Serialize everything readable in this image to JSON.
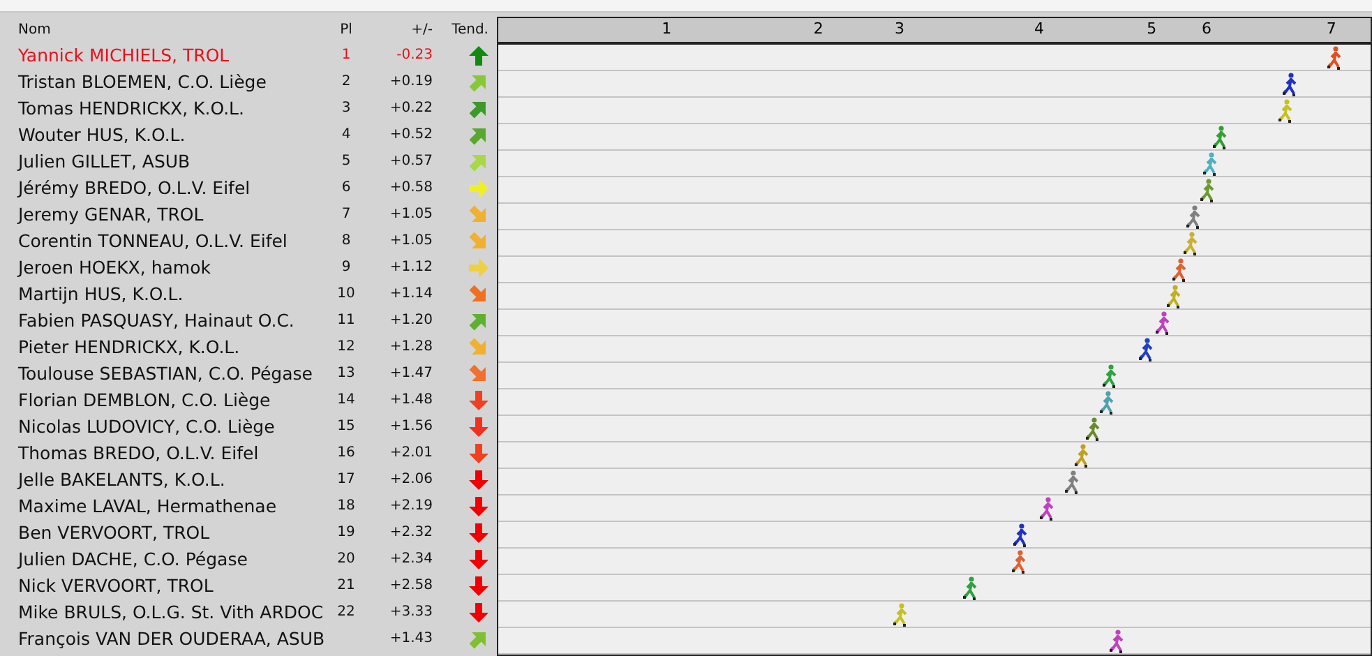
{
  "header": {
    "name": "Nom",
    "place": "Pl",
    "diff": "+/-",
    "trend": "Tend."
  },
  "ticks": [
    {
      "label": "1",
      "level": 0.193
    },
    {
      "label": "2",
      "level": 0.367
    },
    {
      "label": "3",
      "level": 0.46
    },
    {
      "label": "4",
      "level": 0.62
    },
    {
      "label": "5",
      "level": 0.749
    },
    {
      "label": "6",
      "level": 0.812
    },
    {
      "label": "7",
      "level": 0.955
    }
  ],
  "rows": [
    {
      "name": "Yannick MICHIELS, TROL",
      "place": "1",
      "diff": "-0.23",
      "selected": true,
      "trend": {
        "kind": "up",
        "color": "#108a10"
      },
      "runner": {
        "level": 0.958,
        "color": "#e05020"
      }
    },
    {
      "name": "Tristan BLOEMEN, C.O. Liège",
      "place": "2",
      "diff": "+0.19",
      "selected": false,
      "trend": {
        "kind": "up-right",
        "color": "#88c838"
      },
      "runner": {
        "level": 0.907,
        "color": "#2030c0"
      }
    },
    {
      "name": "Tomas HENDRICKX, K.O.L.",
      "place": "3",
      "diff": "+0.22",
      "selected": false,
      "trend": {
        "kind": "up-right",
        "color": "#3c9a28"
      },
      "runner": {
        "level": 0.903,
        "color": "#c8c020"
      }
    },
    {
      "name": "Wouter HUS, K.O.L.",
      "place": "4",
      "diff": "+0.52",
      "selected": false,
      "trend": {
        "kind": "up-right",
        "color": "#58a830"
      },
      "runner": {
        "level": 0.827,
        "color": "#30a030"
      }
    },
    {
      "name": "Julien GILLET, ASUB",
      "place": "5",
      "diff": "+0.57",
      "selected": false,
      "trend": {
        "kind": "up-right",
        "color": "#a8d848"
      },
      "runner": {
        "level": 0.816,
        "color": "#50b0c0"
      }
    },
    {
      "name": "Jérémy BREDO, O.L.V. Eifel",
      "place": "6",
      "diff": "+0.58",
      "selected": false,
      "trend": {
        "kind": "right",
        "color": "#f0f020"
      },
      "runner": {
        "level": 0.812,
        "color": "#6a9a30"
      }
    },
    {
      "name": "Jeremy GENAR, TROL",
      "place": "7",
      "diff": "+1.05",
      "selected": false,
      "trend": {
        "kind": "down-right",
        "color": "#f0b030"
      },
      "runner": {
        "level": 0.796,
        "color": "#808080"
      }
    },
    {
      "name": "Corentin TONNEAU, O.L.V. Eifel",
      "place": "8",
      "diff": "+1.05",
      "selected": false,
      "trend": {
        "kind": "down-right",
        "color": "#f0b030"
      },
      "runner": {
        "level": 0.794,
        "color": "#c8b030"
      }
    },
    {
      "name": "Jeroen HOEKX, hamok",
      "place": "9",
      "diff": "+1.12",
      "selected": false,
      "trend": {
        "kind": "right",
        "color": "#f0d040"
      },
      "runner": {
        "level": 0.781,
        "color": "#e06030"
      }
    },
    {
      "name": "Martijn HUS, K.O.L.",
      "place": "10",
      "diff": "+1.14",
      "selected": false,
      "trend": {
        "kind": "down-right",
        "color": "#f07020"
      },
      "runner": {
        "level": 0.775,
        "color": "#c0b020"
      }
    },
    {
      "name": "Fabien PASQUASY, Hainaut O.C.",
      "place": "11",
      "diff": "+1.20",
      "selected": false,
      "trend": {
        "kind": "up-right",
        "color": "#60b030"
      },
      "runner": {
        "level": 0.762,
        "color": "#c040c0"
      }
    },
    {
      "name": "Pieter HENDRICKX, K.O.L.",
      "place": "12",
      "diff": "+1.28",
      "selected": false,
      "trend": {
        "kind": "down-right",
        "color": "#f0b030"
      },
      "runner": {
        "level": 0.743,
        "color": "#2040c0"
      }
    },
    {
      "name": "Toulouse SEBASTIAN, C.O. Pégase",
      "place": "13",
      "diff": "+1.47",
      "selected": false,
      "trend": {
        "kind": "down-right",
        "color": "#f07030"
      },
      "runner": {
        "level": 0.7,
        "color": "#30a040"
      }
    },
    {
      "name": "Florian DEMBLON, C.O. Liège",
      "place": "14",
      "diff": "+1.48",
      "selected": false,
      "trend": {
        "kind": "down",
        "color": "#f04020"
      },
      "runner": {
        "level": 0.698,
        "color": "#50a0b0"
      }
    },
    {
      "name": "Nicolas LUDOVICY, C.O. Liège",
      "place": "15",
      "diff": "+1.56",
      "selected": false,
      "trend": {
        "kind": "down",
        "color": "#f03020"
      },
      "runner": {
        "level": 0.682,
        "color": "#6a8a30"
      }
    },
    {
      "name": "Thomas BREDO, O.L.V. Eifel",
      "place": "16",
      "diff": "+2.01",
      "selected": false,
      "trend": {
        "kind": "down",
        "color": "#f04020"
      },
      "runner": {
        "level": 0.669,
        "color": "#c0a020"
      }
    },
    {
      "name": "Jelle BAKELANTS, K.O.L.",
      "place": "17",
      "diff": "+2.06",
      "selected": false,
      "trend": {
        "kind": "down",
        "color": "#f00000"
      },
      "runner": {
        "level": 0.657,
        "color": "#808080"
      }
    },
    {
      "name": "Maxime LAVAL, Hermathenae",
      "place": "18",
      "diff": "+2.19",
      "selected": false,
      "trend": {
        "kind": "down",
        "color": "#f00000"
      },
      "runner": {
        "level": 0.628,
        "color": "#c040c0"
      }
    },
    {
      "name": "Ben VERVOORT, TROL",
      "place": "19",
      "diff": "+2.32",
      "selected": false,
      "trend": {
        "kind": "down",
        "color": "#f00000"
      },
      "runner": {
        "level": 0.599,
        "color": "#2030c0"
      }
    },
    {
      "name": "Julien DACHE, C.O. Pégase",
      "place": "20",
      "diff": "+2.34",
      "selected": false,
      "trend": {
        "kind": "down",
        "color": "#f00000"
      },
      "runner": {
        "level": 0.596,
        "color": "#e06030"
      }
    },
    {
      "name": "Nick VERVOORT, TROL",
      "place": "21",
      "diff": "+2.58",
      "selected": false,
      "trend": {
        "kind": "down",
        "color": "#f00000"
      },
      "runner": {
        "level": 0.54,
        "color": "#30a040"
      }
    },
    {
      "name": "Mike BRULS, O.L.G. St. Vith ARDOC",
      "place": "22",
      "diff": "+3.33",
      "selected": false,
      "trend": {
        "kind": "down",
        "color": "#f00000"
      },
      "runner": {
        "level": 0.46,
        "color": "#c8c020"
      }
    },
    {
      "name": "François VAN DER OUDERAA, ASUB",
      "diff": "+1.43",
      "selected": false,
      "trend": {
        "kind": "up-right",
        "color": "#80c030"
      },
      "runner": {
        "level": 0.708,
        "color": "#c040c0"
      }
    }
  ]
}
